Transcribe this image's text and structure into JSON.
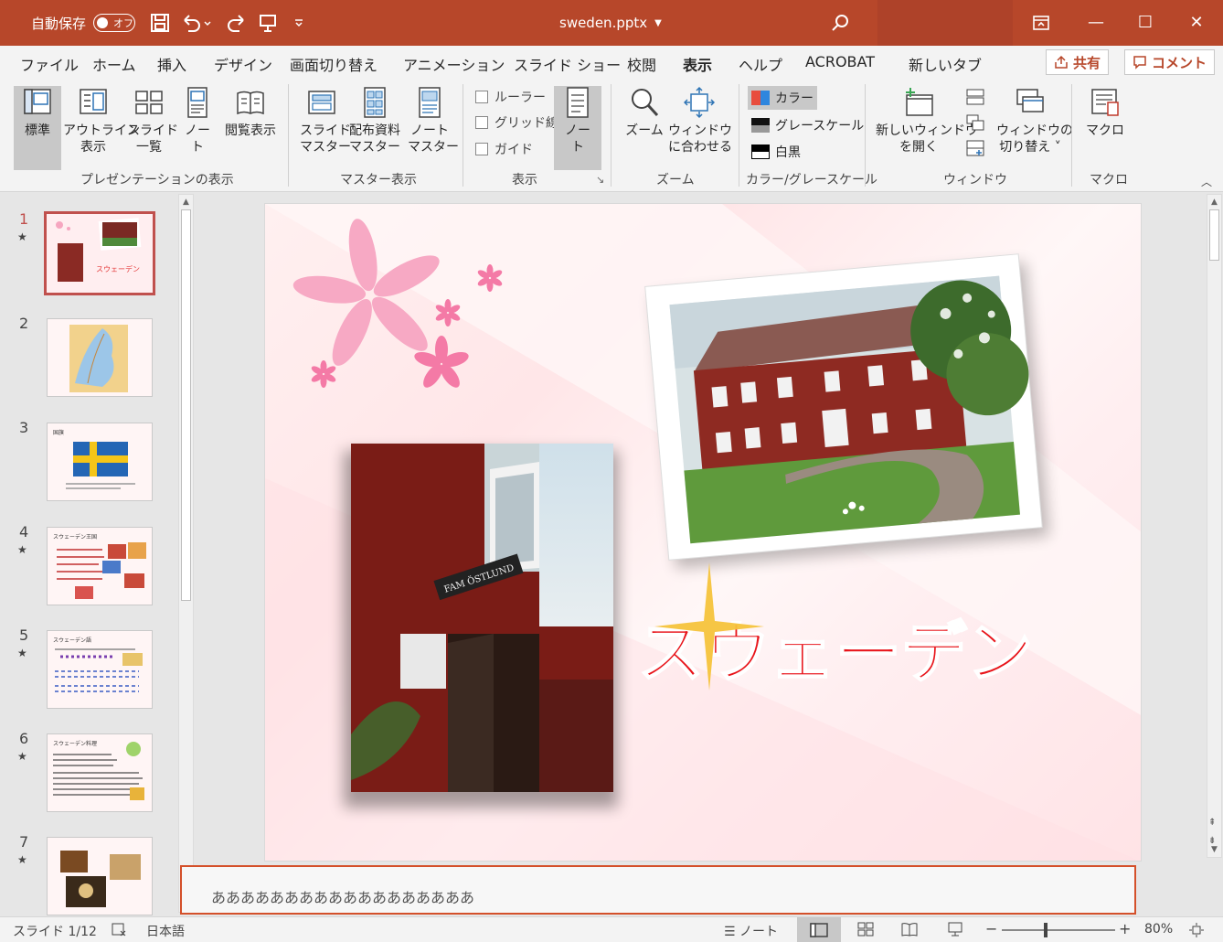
{
  "titlebar": {
    "autosave_label": "自動保存",
    "autosave_state": "オフ",
    "filename": "sweden.pptx",
    "bg_color": "#b7472a"
  },
  "tabs": [
    "ファイル",
    "ホーム",
    "挿入",
    "デザイン",
    "画面切り替え",
    "アニメーション",
    "スライド ショー",
    "校閲",
    "表示",
    "ヘルプ",
    "ACROBAT",
    "新しいタブ"
  ],
  "active_tab": "表示",
  "share_label": "共有",
  "comment_label": "コメント",
  "ribbon": {
    "normal": "標準",
    "outline_1": "アウトライン",
    "outline_2": "表示",
    "sorter_1": "スライド",
    "sorter_2": "一覧",
    "notes_1": "ノー",
    "notes_2": "ト",
    "reading": "閲覧表示",
    "group_presentation": "プレゼンテーションの表示",
    "slide_master_1": "スライド",
    "slide_master_2": "マスター",
    "handout_1": "配布資料",
    "handout_2": "マスター",
    "notes_master_1": "ノート",
    "notes_master_2": "マスター",
    "group_master": "マスター表示",
    "ruler": "ルーラー",
    "gridlines": "グリッド線",
    "guides": "ガイド",
    "notes_btn_1": "ノー",
    "notes_btn_2": "ト",
    "group_show": "表示",
    "zoom": "ズーム",
    "fit_1": "ウィンドウ",
    "fit_2": "に合わせる",
    "group_zoom": "ズーム",
    "color": "カラー",
    "grayscale": "グレースケール",
    "bw": "白黒",
    "group_color": "カラー/グレースケール",
    "newwin_1": "新しいウィンドウ",
    "newwin_2": "を開く",
    "switch_1": "ウィンドウの",
    "switch_2": "切り替え ˅",
    "group_window": "ウィンドウ",
    "macro": "マクロ",
    "group_macro": "マクロ"
  },
  "thumbnails": [
    {
      "num": "1",
      "star": "★"
    },
    {
      "num": "2",
      "star": ""
    },
    {
      "num": "3",
      "star": ""
    },
    {
      "num": "4",
      "star": "★"
    },
    {
      "num": "5",
      "star": "★"
    },
    {
      "num": "6",
      "star": "★"
    },
    {
      "num": "7",
      "star": "★"
    }
  ],
  "thumb_texts": {
    "t3_title": "国旗",
    "t4_title": "スウェーデン王国",
    "t5_title": "スウェーデン語",
    "t6_title": "スウェーデン料理"
  },
  "slide": {
    "title": "スウェーデン",
    "door_sign": "FAM ÖSTLUND"
  },
  "notes_text": "ああああああああああああああああああ",
  "status": {
    "slide_pos": "スライド 1/12",
    "language": "日本語",
    "notes": "ノート",
    "zoom": "80%",
    "zoom_fraction": 0.8
  }
}
